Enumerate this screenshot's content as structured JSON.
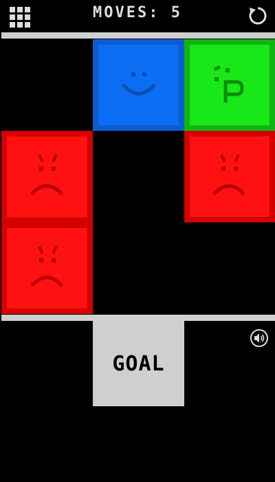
{
  "header": {
    "moves_label": "MOVES: 5"
  },
  "icons": {
    "menu": "grid-menu-icon",
    "restart": "restart-icon",
    "sound": "speaker-icon"
  },
  "colors": {
    "background": "#000000",
    "divider": "#cfcfcf",
    "blue_block": "#0b6ef5",
    "green_block": "#18e818",
    "red_block": "#ff1111",
    "goal": "#cfcfcf"
  },
  "board": {
    "blocks": [
      {
        "name": "blue-smile-block",
        "color": "blue",
        "face": "smile"
      },
      {
        "name": "green-tongue-block",
        "color": "green",
        "face": "tongue"
      },
      {
        "name": "red-angry-tall-block",
        "color": "red",
        "face": "angry",
        "cells": 2
      },
      {
        "name": "red-angry-block",
        "color": "red",
        "face": "angry"
      }
    ],
    "goal_label": "GOAL"
  }
}
